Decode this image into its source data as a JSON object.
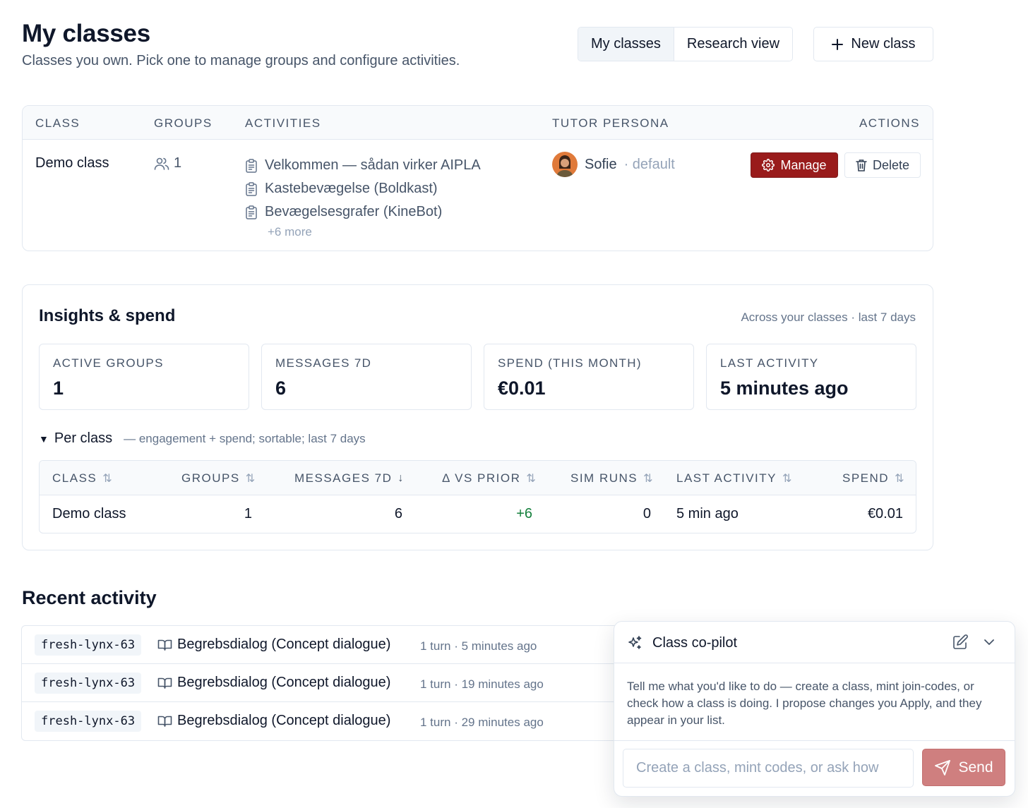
{
  "header": {
    "title": "My classes",
    "subtitle": "Classes you own. Pick one to manage groups and configure activities.",
    "view_tabs": [
      {
        "label": "My classes",
        "active": true
      },
      {
        "label": "Research view",
        "active": false
      }
    ],
    "new_class_label": "New class"
  },
  "classes_table": {
    "columns": {
      "class": "CLASS",
      "groups": "GROUPS",
      "activities": "ACTIVITIES",
      "tutor": "TUTOR PERSONA",
      "actions": "ACTIONS"
    },
    "rows": [
      {
        "name": "Demo class",
        "groups": "1",
        "activities": [
          "Velkommen — sådan virker AIPLA",
          "Kastebevægelse (Boldkast)",
          "Bevægelsesgrafer (KineBot)"
        ],
        "more": "+6 more",
        "tutor_name": "Sofie",
        "tutor_tag": "· default",
        "manage_label": "Manage",
        "delete_label": "Delete"
      }
    ]
  },
  "insights": {
    "title": "Insights & spend",
    "meta": "Across your classes · last 7 days",
    "stats": [
      {
        "label": "ACTIVE GROUPS",
        "value": "1"
      },
      {
        "label": "MESSAGES 7D",
        "value": "6"
      },
      {
        "label": "SPEND (THIS MONTH)",
        "value": "€0.01"
      },
      {
        "label": "LAST ACTIVITY",
        "value": "5 minutes ago"
      }
    ],
    "per_class": {
      "toggle": "▼",
      "label": "Per class",
      "note": "— engagement + spend; sortable; last 7 days",
      "columns": {
        "class": "CLASS",
        "groups": "GROUPS",
        "messages": "MESSAGES 7D",
        "delta": "Δ VS PRIOR",
        "sim_runs": "SIM RUNS",
        "last_activity": "LAST ACTIVITY",
        "spend": "SPEND"
      },
      "sorted_by": "messages",
      "rows": [
        {
          "class": "Demo class",
          "groups": "1",
          "messages": "6",
          "delta": "+6",
          "sim_runs": "0",
          "last_activity": "5 min ago",
          "spend": "€0.01"
        }
      ]
    }
  },
  "recent": {
    "title": "Recent activity",
    "items": [
      {
        "code": "fresh-lynx-63",
        "activity": "Begrebsdialog (Concept dialogue)",
        "meta": "1 turn · 5 minutes ago"
      },
      {
        "code": "fresh-lynx-63",
        "activity": "Begrebsdialog (Concept dialogue)",
        "meta": "1 turn · 19 minutes ago"
      },
      {
        "code": "fresh-lynx-63",
        "activity": "Begrebsdialog (Concept dialogue)",
        "meta": "1 turn · 29 minutes ago"
      }
    ]
  },
  "copilot": {
    "title": "Class co-pilot",
    "intro": "Tell me what you'd like to do — create a class, mint join-codes, or check how a class is doing. I propose changes you Apply, and they appear in your list.",
    "input_placeholder": "Create a class, mint codes, or ask how",
    "input_value": "",
    "send_label": "Send"
  },
  "icons": {
    "new_class": "plus-icon",
    "groups": "users-icon",
    "activity": "clipboard-icon",
    "manage": "gear-icon",
    "delete": "trash-icon",
    "sort": "sort-arrows-icon",
    "sorted_desc": "arrow-down-icon",
    "recent_activity": "book-open-icon",
    "copilot": "sparkles-icon",
    "copilot_edit": "edit-icon",
    "copilot_collapse": "chevron-down-icon",
    "send": "send-icon"
  },
  "colors": {
    "primary": "#991b1b",
    "send_button": "#cf7f7f",
    "positive": "#15803d",
    "muted_text": "#475569",
    "border": "#e2e8f0"
  }
}
